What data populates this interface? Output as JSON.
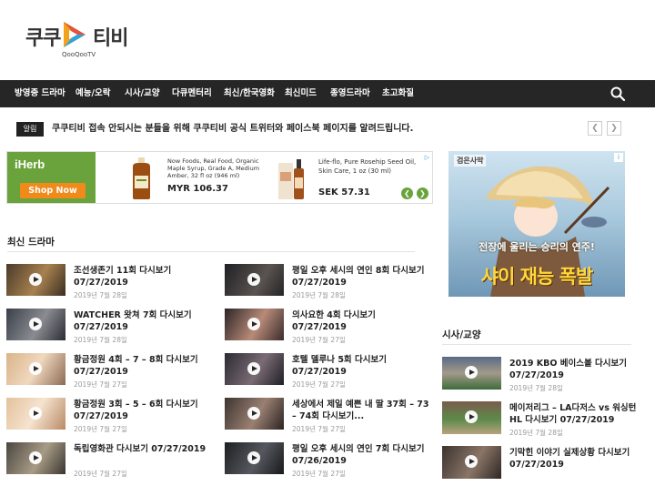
{
  "logo": {
    "left": "쿠쿠",
    "right": "티비",
    "sub": "QooQooTV"
  },
  "nav": {
    "items": [
      "방영중 드라마",
      "예능/오락",
      "시사/교양",
      "다큐멘터리",
      "최신/한국영화",
      "최신미드",
      "종영드라마",
      "초고화질"
    ]
  },
  "ticker": {
    "badge": "알림",
    "text": "쿠쿠티비 접속 안되시는 분들을 위해 쿠쿠티비 공식 트위터와 페이스북 페이지를 알려드립니다."
  },
  "ad_iherb": {
    "brand": "iHerb",
    "cta": "Shop Now",
    "p1_desc": "Now Foods, Real Food, Organic Maple Syrup, Grade A, Medium Amber, 32 fl oz (946 ml)",
    "p1_price": "MYR 106.37",
    "p2_desc": "Life-flo, Pure Rosehip Seed Oil, Skin Care, 1 oz (30 ml)",
    "p2_price": "SEK 57.31"
  },
  "ad_game": {
    "logo": "검은사막",
    "sub": "전장에 울리는 승리의 연주!",
    "main": "샤이 재능 폭발"
  },
  "recent_drama": {
    "title": "최신 드라마",
    "items": [
      {
        "title": "조선생존기 11회 다시보기 07/27/2019",
        "date": "2019년 7월 28일"
      },
      {
        "title": "평일 오후 세시의 연인 8회 다시보기 07/27/2019",
        "date": "2019년 7월 28일"
      },
      {
        "title": "WATCHER 왓쳐 7회 다시보기 07/27/2019",
        "date": "2019년 7월 28일"
      },
      {
        "title": "의사요한 4회 다시보기 07/27/2019",
        "date": "2019년 7월 27일"
      },
      {
        "title": "황금정원 4회 – 7 – 8회 다시보기 07/27/2019",
        "date": "2019년 7월 27일"
      },
      {
        "title": "호텔 델루나 5회 다시보기 07/27/2019",
        "date": "2019년 7월 27일"
      },
      {
        "title": "황금정원 3회 – 5 – 6회 다시보기 07/27/2019",
        "date": "2019년 7월 27일"
      },
      {
        "title": "세상에서 제일 예쁜 내 딸 37회 – 73 – 74회 다시보기...",
        "date": "2019년 7월 27일"
      },
      {
        "title": "독립영화관 다시보기 07/27/2019",
        "date": "2019년 7월 27일"
      },
      {
        "title": "평일 오후 세시의 연인 7회 다시보기 07/26/2019",
        "date": "2019년 7월 27일"
      }
    ]
  },
  "sisa": {
    "title": "시사/교양",
    "items": [
      {
        "title": "2019 KBO 베이스볼 다시보기 07/27/2019",
        "date": "2019년 7월 28일"
      },
      {
        "title": "메이저리그 – LA다저스 vs 워싱턴 HL 다시보기 07/27/2019",
        "date": "2019년 7월 28일"
      },
      {
        "title": "기막힌 이야기 실제상황 다시보기 07/27/2019",
        "date": ""
      }
    ]
  },
  "colors": {
    "nav_bg": "#262626",
    "iherb_green": "#6aa33c",
    "iherb_orange": "#f08a1a"
  }
}
